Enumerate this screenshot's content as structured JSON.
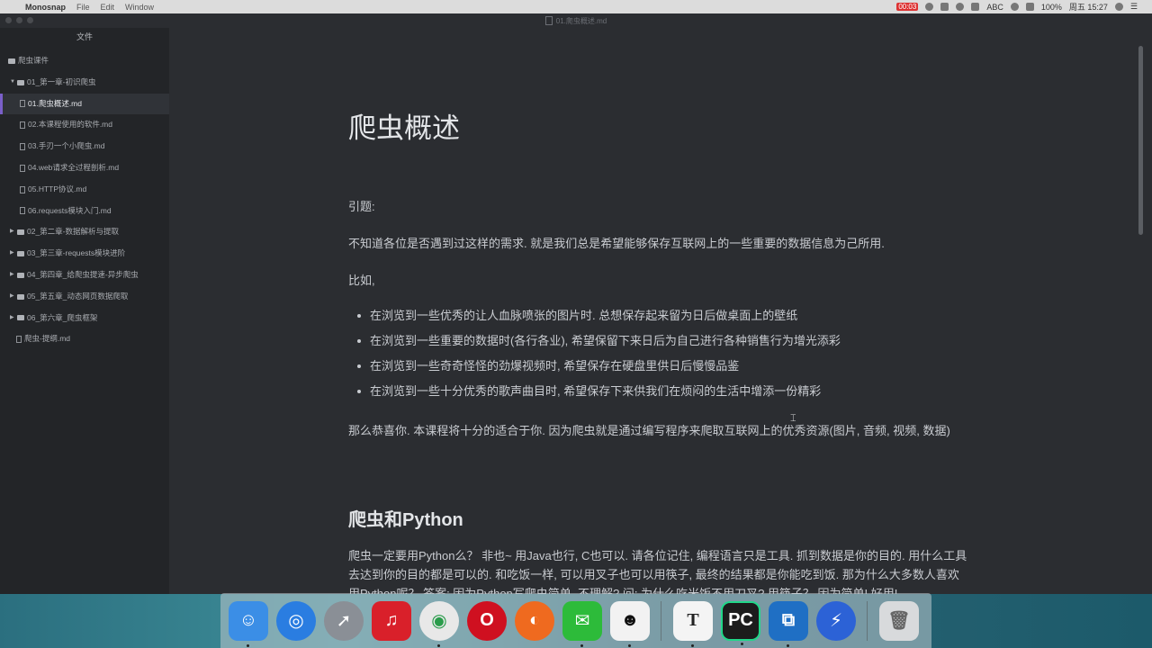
{
  "menubar": {
    "app_name": "Monosnap",
    "items": [
      "File",
      "Edit",
      "Window"
    ],
    "rec_time": "00:03",
    "input_method": "ABC",
    "battery": "100%",
    "clock": "周五 15:27"
  },
  "window": {
    "title": "01.爬虫概述.md"
  },
  "sidebar": {
    "title": "文件",
    "root": "爬虫课件",
    "items": [
      {
        "label": "01_第一章-初识爬虫",
        "kind": "folder",
        "expanded": true
      },
      {
        "label": "01.爬虫概述.md",
        "kind": "file",
        "active": true
      },
      {
        "label": "02.本课程使用的软件.md",
        "kind": "file"
      },
      {
        "label": "03.手刃一个小爬虫.md",
        "kind": "file"
      },
      {
        "label": "04.web请求全过程剖析.md",
        "kind": "file"
      },
      {
        "label": "05.HTTP协议.md",
        "kind": "file"
      },
      {
        "label": "06.requests模块入门.md",
        "kind": "file"
      },
      {
        "label": "02_第二章-数据解析与提取",
        "kind": "folder"
      },
      {
        "label": "03_第三章-requests模块进阶",
        "kind": "folder"
      },
      {
        "label": "04_第四章_给爬虫提速-异步爬虫",
        "kind": "folder"
      },
      {
        "label": "05_第五章_动态网页数据爬取",
        "kind": "folder"
      },
      {
        "label": "06_第六章_爬虫框架",
        "kind": "folder"
      },
      {
        "label": "爬虫-提纲.md",
        "kind": "file"
      }
    ]
  },
  "article": {
    "title": "爬虫概述",
    "intro_label": "引题:",
    "intro_text": "不知道各位是否遇到过这样的需求. 就是我们总是希望能够保存互联网上的一些重要的数据信息为己所用.",
    "example_label": "比如,",
    "bullets": [
      "在浏览到一些优秀的让人血脉喷张的图片时. 总想保存起来留为日后做桌面上的壁纸",
      "在浏览到一些重要的数据时(各行各业), 希望保留下来日后为自己进行各种销售行为增光添彩",
      "在浏览到一些奇奇怪怪的劲爆视频时, 希望保存在硬盘里供日后慢慢品鉴",
      "在浏览到一些十分优秀的歌声曲目时, 希望保存下来供我们在烦闷的生活中增添一份精彩"
    ],
    "conclusion": "那么恭喜你. 本课程将十分的适合于你. 因为爬虫就是通过编写程序来爬取互联网上的优秀资源(图片, 音频, 视频, 数据)",
    "section_title": "爬虫和Python",
    "section_paragraph": "爬虫一定要用Python么？ 非也~ 用Java也行, C也可以. 请各位记住, 编程语言只是工具. 抓到数据是你的目的. 用什么工具去达到你的目的都是可以的. 和吃饭一样, 可以用叉子也可以用筷子, 最终的结果都是你能吃到饭. 那为什么大多数人喜欢用Python呢？ 答案: 因为Python写爬虫简单. 不理解? 问: 为什么吃米饭不用刀叉? 用筷子？ 因为简单! 好用!"
  },
  "dock": {
    "apps": [
      {
        "name": "finder-icon",
        "color": "#3b8ee6",
        "glyph": "☺"
      },
      {
        "name": "safari-icon",
        "color": "#2a7de1",
        "glyph": "◎"
      },
      {
        "name": "launchpad-icon",
        "color": "#8a8f96",
        "glyph": "➚"
      },
      {
        "name": "netease-music-icon",
        "color": "#d9202a",
        "glyph": "♫"
      },
      {
        "name": "chrome-icon",
        "color": "#e8e8e8",
        "glyph": "◉"
      },
      {
        "name": "opera-icon",
        "color": "#cf1020",
        "glyph": "O"
      },
      {
        "name": "firefox-icon",
        "color": "#ef6a1f",
        "glyph": "◐"
      },
      {
        "name": "wechat-icon",
        "color": "#2dbb3a",
        "glyph": "✉"
      },
      {
        "name": "qq-icon",
        "color": "#f2f2f2",
        "glyph": "☻"
      },
      {
        "name": "typora-icon",
        "color": "#f4f4f4",
        "glyph": "T"
      },
      {
        "name": "pycharm-icon",
        "color": "#1c1c1c",
        "glyph": "PC"
      },
      {
        "name": "remote-desktop-icon",
        "color": "#1f6fc4",
        "glyph": "⧉"
      },
      {
        "name": "thunder-icon",
        "color": "#2c62d6",
        "glyph": "⚡"
      },
      {
        "name": "trash-icon",
        "color": "#d8dadc",
        "glyph": "🗑"
      }
    ]
  }
}
